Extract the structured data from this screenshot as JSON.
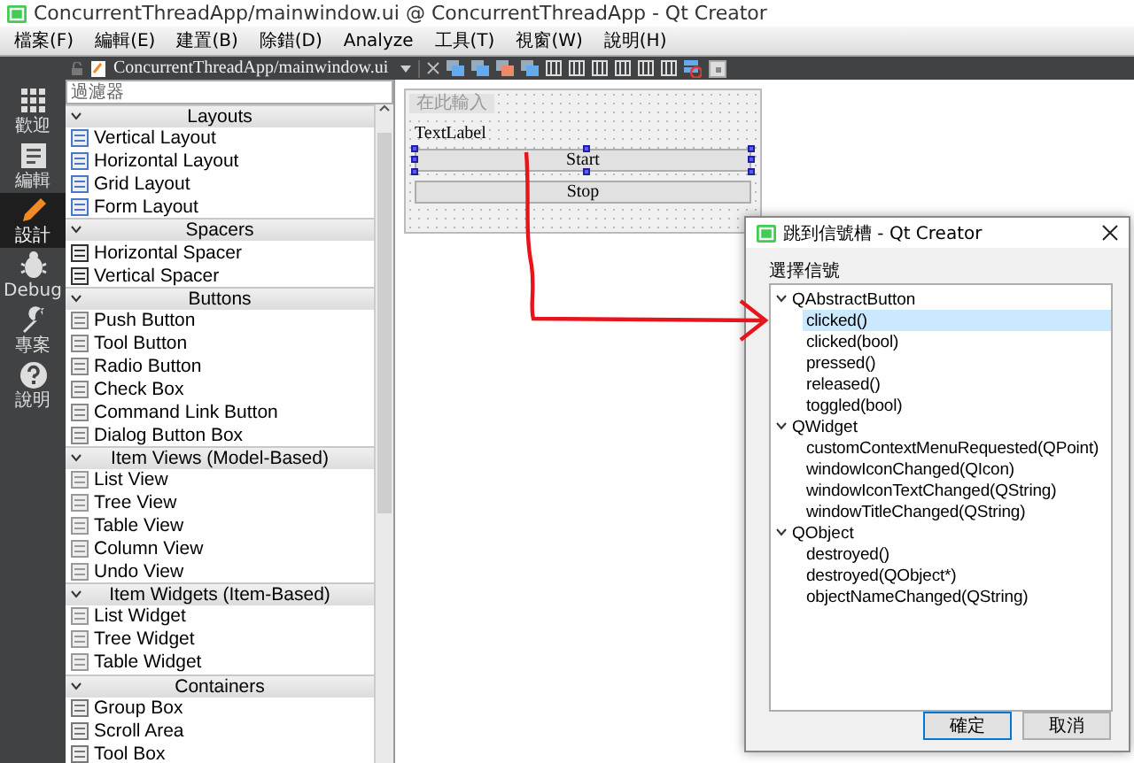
{
  "window": {
    "title": "ConcurrentThreadApp/mainwindow.ui @ ConcurrentThreadApp - Qt Creator"
  },
  "menu": [
    "檔案(F)",
    "編輯(E)",
    "建置(B)",
    "除錯(D)",
    "Analyze",
    "工具(T)",
    "視窗(W)",
    "說明(H)"
  ],
  "editor_tab": {
    "title": "ConcurrentThreadApp/mainwindow.ui"
  },
  "mode_bar": [
    {
      "label": "歡迎",
      "selected": false
    },
    {
      "label": "編輯",
      "selected": false
    },
    {
      "label": "設計",
      "selected": true
    },
    {
      "label": "Debug",
      "selected": false
    },
    {
      "label": "專案",
      "selected": false
    },
    {
      "label": "說明",
      "selected": false
    }
  ],
  "widget_box": {
    "filter": {
      "placeholder": "過濾器"
    },
    "categories": [
      {
        "title": "Layouts",
        "expanded": true,
        "items": [
          "Vertical Layout",
          "Horizontal Layout",
          "Grid Layout",
          "Form Layout"
        ]
      },
      {
        "title": "Spacers",
        "expanded": true,
        "items": [
          "Horizontal Spacer",
          "Vertical Spacer"
        ]
      },
      {
        "title": "Buttons",
        "expanded": true,
        "items": [
          "Push Button",
          "Tool Button",
          "Radio Button",
          "Check Box",
          "Command Link Button",
          "Dialog Button Box"
        ]
      },
      {
        "title": "Item Views (Model-Based)",
        "expanded": true,
        "items": [
          "List View",
          "Tree View",
          "Table View",
          "Column View",
          "Undo View"
        ]
      },
      {
        "title": "Item Widgets (Item-Based)",
        "expanded": true,
        "items": [
          "List Widget",
          "Tree Widget",
          "Table Widget"
        ]
      },
      {
        "title": "Containers",
        "expanded": true,
        "items": [
          "Group Box",
          "Scroll Area",
          "Tool Box"
        ]
      }
    ]
  },
  "form": {
    "menu_placeholder": "在此輸入",
    "label": "TextLabel",
    "buttons": [
      {
        "label": "Start",
        "selected": true
      },
      {
        "label": "Stop",
        "selected": false
      }
    ]
  },
  "dialog": {
    "title": "跳到信號槽 - Qt Creator",
    "group_title": "選擇信號",
    "tree": [
      {
        "label": "QAbstractButton",
        "expanded": true,
        "selected": false,
        "children": [
          {
            "label": "clicked()",
            "selected": true
          },
          {
            "label": "clicked(bool)",
            "selected": false
          },
          {
            "label": "pressed()",
            "selected": false
          },
          {
            "label": "released()",
            "selected": false
          },
          {
            "label": "toggled(bool)",
            "selected": false
          }
        ]
      },
      {
        "label": "QWidget",
        "expanded": true,
        "selected": false,
        "children": [
          {
            "label": "customContextMenuRequested(QPoint)",
            "selected": false
          },
          {
            "label": "windowIconChanged(QIcon)",
            "selected": false
          },
          {
            "label": "windowIconTextChanged(QString)",
            "selected": false
          },
          {
            "label": "windowTitleChanged(QString)",
            "selected": false
          }
        ]
      },
      {
        "label": "QObject",
        "expanded": true,
        "selected": false,
        "children": [
          {
            "label": "destroyed()",
            "selected": false
          },
          {
            "label": "destroyed(QObject*)",
            "selected": false
          },
          {
            "label": "objectNameChanged(QString)",
            "selected": false
          }
        ]
      }
    ],
    "buttons": [
      {
        "label": "確定",
        "default": true
      },
      {
        "label": "取消",
        "default": false
      }
    ]
  }
}
